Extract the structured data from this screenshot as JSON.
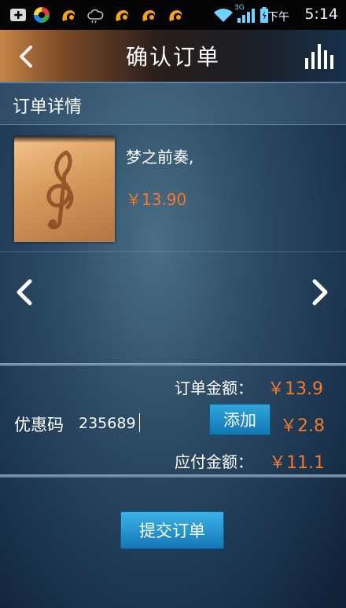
{
  "status_bar": {
    "time_prefix": "下午",
    "time": "5:14",
    "network_label": "3G",
    "icons": [
      "add-icon",
      "circle-logo-icon",
      "uc-squirrel-icon",
      "cloud-icon",
      "uc-squirrel-icon",
      "uc-squirrel-icon",
      "uc-squirrel-icon",
      "wifi-icon",
      "signal-icon",
      "battery-icon"
    ],
    "accent": "#6fd3ff"
  },
  "header": {
    "title": "确认订单",
    "back_icon": "chevron-left-icon",
    "right_icon": "bar-chart-icon"
  },
  "order": {
    "section_title": "订单详情",
    "product": {
      "name": "梦之前奏,",
      "price": "￥13.90",
      "image_icon": "treble-clef-icon"
    }
  },
  "carousel": {
    "prev_icon": "chevron-left-icon",
    "next_icon": "chevron-right-icon"
  },
  "summary": {
    "order_amount_label": "订单金额：",
    "order_amount": "￥13.9",
    "coupon_label": "优惠码",
    "coupon_value": "235689",
    "add_label": "添加",
    "discount": "￥2.8",
    "payable_label": "应付金额：",
    "payable_amount": "￥11.1"
  },
  "actions": {
    "submit_label": "提交订单"
  },
  "colors": {
    "price": "#f07a2c",
    "button": "#1a8fcf"
  }
}
